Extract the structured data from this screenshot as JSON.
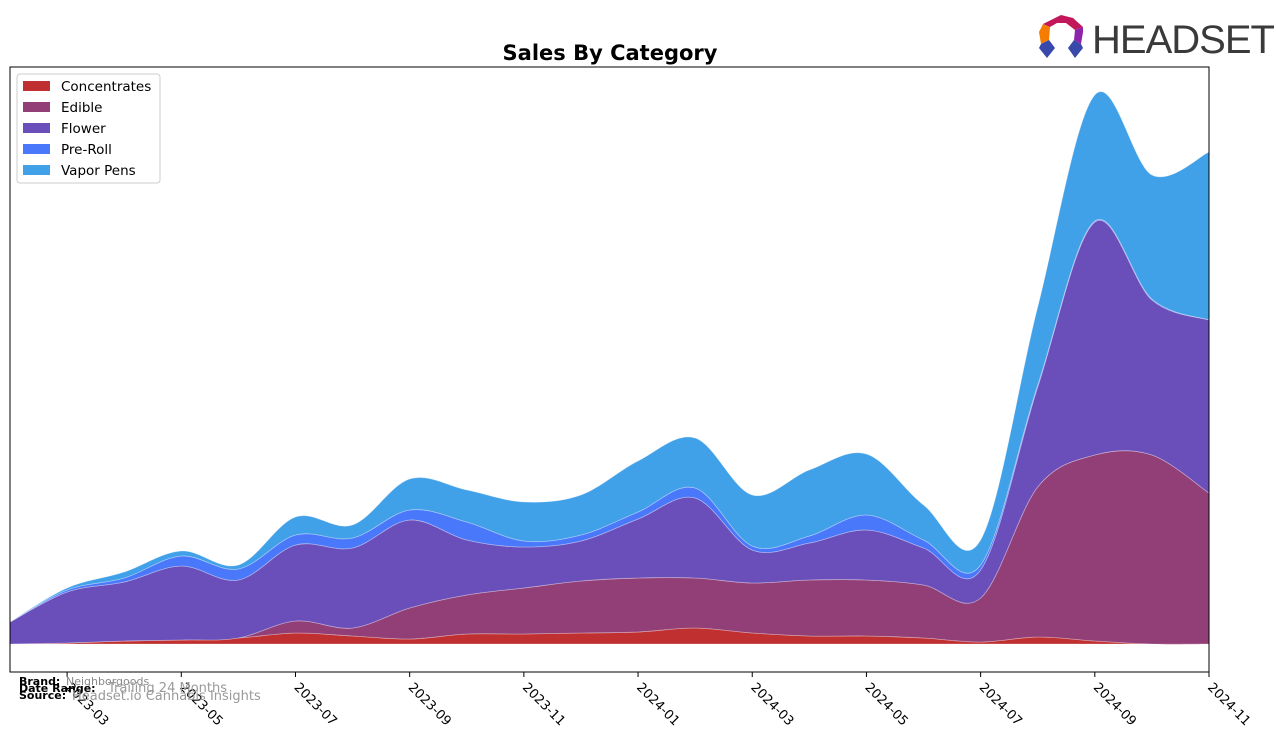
{
  "chart_data": {
    "type": "area",
    "stacked": true,
    "smooth": true,
    "title": "Sales By Category",
    "xlabel": "",
    "ylabel": "",
    "x": [
      "2023-02",
      "2023-03",
      "2023-04",
      "2023-05",
      "2023-06",
      "2023-07",
      "2023-08",
      "2023-09",
      "2023-10",
      "2023-11",
      "2023-12",
      "2024-01",
      "2024-02",
      "2024-03",
      "2024-04",
      "2024-05",
      "2024-06",
      "2024-07",
      "2024-08",
      "2024-09",
      "2024-10",
      "2024-11"
    ],
    "x_ticks": [
      "2023-03",
      "2023-05",
      "2023-07",
      "2023-09",
      "2023-11",
      "2024-01",
      "2024-03",
      "2024-05",
      "2024-07",
      "2024-09",
      "2024-11"
    ],
    "y_ticks_visible": false,
    "ylim": [
      -55,
      1000
    ],
    "grid": false,
    "legend_position": "top-left",
    "series": [
      {
        "name": "Concentrates",
        "color": "#c03030",
        "values": [
          0,
          1,
          3,
          4,
          6,
          11,
          8,
          5,
          10,
          10,
          11,
          12,
          16,
          11,
          8,
          8,
          6,
          2,
          7,
          3,
          0,
          0
        ]
      },
      {
        "name": "Edible",
        "color": "#933f77",
        "values": [
          0,
          0,
          0,
          0,
          0,
          12,
          8,
          31,
          39,
          46,
          52,
          54,
          50,
          50,
          56,
          56,
          53,
          44,
          150,
          186,
          189,
          151
        ]
      },
      {
        "name": "Flower",
        "color": "#6a4fbb",
        "values": [
          22,
          51,
          59,
          74,
          58,
          76,
          80,
          88,
          55,
          41,
          40,
          59,
          80,
          33,
          37,
          50,
          37,
          28,
          100,
          233,
          155,
          173
        ]
      },
      {
        "name": "Pre-Roll",
        "color": "#4a78fa",
        "values": [
          0,
          2,
          4,
          10,
          11,
          10,
          10,
          10,
          18,
          6,
          6,
          7,
          10,
          4,
          7,
          15,
          8,
          5,
          2,
          1,
          1,
          0
        ]
      },
      {
        "name": "Vapor Pens",
        "color": "#40a0e8",
        "values": [
          0,
          2,
          6,
          5,
          4,
          18,
          13,
          31,
          32,
          39,
          40,
          51,
          50,
          51,
          66,
          61,
          35,
          25,
          78,
          126,
          124,
          168
        ]
      }
    ]
  },
  "footer": {
    "brand_label": "Brand:",
    "brand_value": "Neighborgoods",
    "date_range_label": "Date Range:",
    "date_range_value": "Trailing 24 Months",
    "source_label": "Source:",
    "source_value": "Headset.io Cannabis Insights"
  },
  "logo": {
    "text": "HEADSET"
  }
}
